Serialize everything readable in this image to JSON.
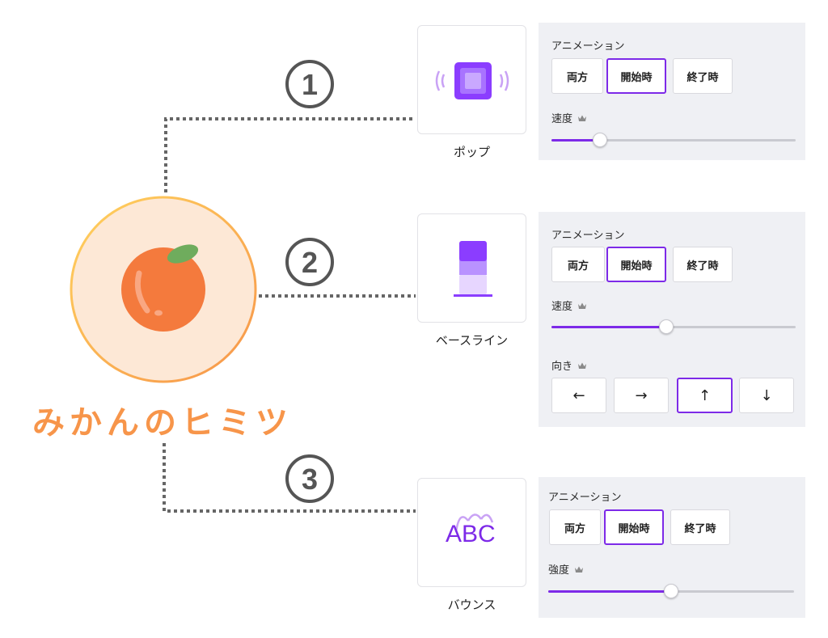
{
  "hero": {
    "title": "みかんのヒミツ",
    "icon": "tangerine-icon"
  },
  "steps": [
    {
      "number": "①",
      "thumb_label": "ポップ",
      "thumb_icon": "pop-animation-icon",
      "animation_label": "アニメーション",
      "options": [
        "両方",
        "開始時",
        "終了時"
      ],
      "selected_option": "開始時",
      "slider_label": "速度",
      "slider_value_fraction": 0.2
    },
    {
      "number": "②",
      "thumb_label": "ベースライン",
      "thumb_icon": "baseline-animation-icon",
      "animation_label": "アニメーション",
      "options": [
        "両方",
        "開始時",
        "終了時"
      ],
      "selected_option": "開始時",
      "slider_label": "速度",
      "slider_value_fraction": 0.47,
      "direction_label": "向き",
      "directions": [
        "←",
        "→",
        "↑",
        "↓"
      ],
      "selected_direction": "↑"
    },
    {
      "number": "③",
      "thumb_label": "バウンス",
      "thumb_icon": "bounce-animation-icon",
      "thumb_text": "ABC",
      "animation_label": "アニメーション",
      "options": [
        "両方",
        "開始時",
        "終了時"
      ],
      "selected_option": "開始時",
      "slider_label": "強度",
      "slider_value_fraction": 0.5
    }
  ],
  "colors": {
    "accent": "#7d2ae8",
    "orange": "#f7954a",
    "panel_bg": "#eff0f4",
    "connector": "#666666"
  }
}
